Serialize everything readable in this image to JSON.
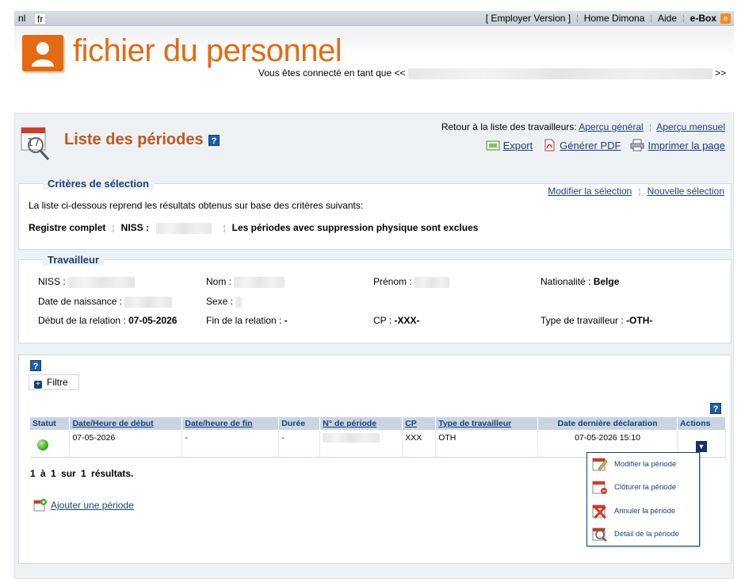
{
  "topbar": {
    "lang_nl": "nl",
    "lang_fr": "fr",
    "employer_version": "[ Employer Version ]",
    "home": "Home Dimona",
    "aide": "Aide",
    "ebox": "e-Box",
    "ebox_badge": "e"
  },
  "banner": {
    "brand": "fichier du personnel",
    "connected_prefix": "Vous êtes connecté en tant que <<",
    "connected_suffix": ">>"
  },
  "page": {
    "title": "Liste des périodes",
    "help": "?",
    "back_prefix": "Retour à la liste des travailleurs:",
    "back_general": "Aperçu général",
    "back_monthly": "Aperçu mensuel",
    "export": "Export",
    "pdf": "Générer PDF",
    "print": "Imprimer la page"
  },
  "criteria": {
    "legend": "Critères de sélection",
    "modify": "Modifier la sélection",
    "new": "Nouvelle sélection",
    "description": "La liste ci-dessous reprend les résultats obtenus sur base des critères suivants:",
    "registre": "Registre complet",
    "niss": "NISS :",
    "exclusion": "Les périodes avec suppression physique sont exclues"
  },
  "worker": {
    "legend": "Travailleur",
    "niss_label": "NISS :",
    "nom_label": "Nom :",
    "prenom_label": "Prénom :",
    "nat_label": "Nationalité :",
    "nat_value": "Belge",
    "birth_label": "Date de naissance :",
    "sexe_label": "Sexe :",
    "start_label": "Début de la relation :",
    "start_value": "07-05-2026",
    "end_label": "Fin de la relation :",
    "end_value": "-",
    "cp_label": "CP :",
    "cp_value": "-XXX-",
    "type_label": "Type de travailleur :",
    "type_value": "-OTH-"
  },
  "list": {
    "filter": "Filtre",
    "plus": "+",
    "headers": [
      "Statut",
      "Date/Heure de début",
      "Date/heure de fin",
      "Durée",
      "N° de période",
      "CP",
      "Type de travailleur",
      "Date dernière déclaration",
      "Actions"
    ],
    "row": {
      "start": "07-05-2026",
      "end": "-",
      "duration": "-",
      "cp": "XXX",
      "type": "OTH",
      "last_decl": "07-05-2026 15:10",
      "action_glyph": "▼"
    },
    "result_count": "1 à 1 sur 1 résultats.",
    "add_period": "Ajouter une période"
  },
  "actions_menu": {
    "items": [
      "Modifier la période",
      "Clôturer la période",
      "Annuler la période",
      "Détail de la période"
    ]
  },
  "colors": {
    "brand_orange": "#e36a12",
    "title_orange": "#c0561e",
    "link_blue": "#1a3f7a",
    "header_bg": "#c9d5e2",
    "status_green": "#3fae26"
  }
}
